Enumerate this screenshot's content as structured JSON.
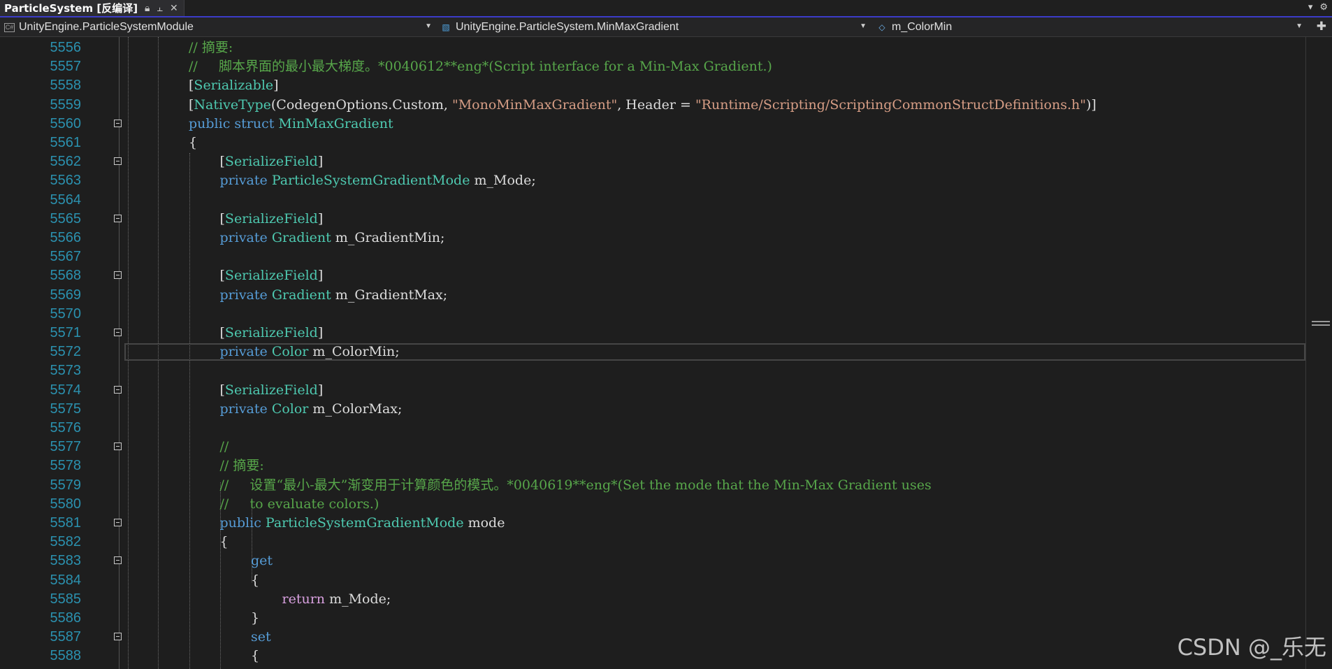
{
  "tab": {
    "title": "ParticleSystem [反编译]",
    "lock_icon": "lock-icon",
    "pin_icon": "pin-icon",
    "close_icon": "close-icon"
  },
  "navbar": {
    "project": "UnityEngine.ParticleSystemModule",
    "type": "UnityEngine.ParticleSystem.MinMaxGradient",
    "member": "m_ColorMin"
  },
  "editor": {
    "lines": [
      {
        "num": "5556",
        "indent": 2,
        "tokens": [
          [
            "c",
            "// 摘要:"
          ]
        ]
      },
      {
        "num": "5557",
        "indent": 2,
        "tokens": [
          [
            "c",
            "//     脚本界面的最小最大梯度。*0040612**eng*(Script interface for a Min-Max Gradient.)"
          ]
        ]
      },
      {
        "num": "5558",
        "indent": 2,
        "tokens": [
          [
            "p",
            "["
          ],
          [
            "t",
            "Serializable"
          ],
          [
            "p",
            "]"
          ]
        ]
      },
      {
        "num": "5559",
        "indent": 2,
        "tokens": [
          [
            "p",
            "["
          ],
          [
            "t",
            "NativeType"
          ],
          [
            "p",
            "(CodegenOptions.Custom, "
          ],
          [
            "s",
            "\"MonoMinMaxGradient\""
          ],
          [
            "p",
            ", Header = "
          ],
          [
            "s",
            "\"Runtime/Scripting/ScriptingCommonStructDefinitions.h\""
          ],
          [
            "p",
            ")]"
          ]
        ]
      },
      {
        "num": "5560",
        "indent": 2,
        "fold": true,
        "tokens": [
          [
            "k",
            "public struct "
          ],
          [
            "t",
            "MinMaxGradient"
          ]
        ]
      },
      {
        "num": "5561",
        "indent": 2,
        "tokens": [
          [
            "p",
            "{"
          ]
        ]
      },
      {
        "num": "5562",
        "indent": 3,
        "fold": true,
        "tokens": [
          [
            "p",
            "["
          ],
          [
            "t",
            "SerializeField"
          ],
          [
            "p",
            "]"
          ]
        ]
      },
      {
        "num": "5563",
        "indent": 3,
        "tokens": [
          [
            "k",
            "private "
          ],
          [
            "t",
            "ParticleSystemGradientMode"
          ],
          [
            "p",
            " m_Mode;"
          ]
        ]
      },
      {
        "num": "5564",
        "indent": 3,
        "tokens": []
      },
      {
        "num": "5565",
        "indent": 3,
        "fold": true,
        "tokens": [
          [
            "p",
            "["
          ],
          [
            "t",
            "SerializeField"
          ],
          [
            "p",
            "]"
          ]
        ]
      },
      {
        "num": "5566",
        "indent": 3,
        "tokens": [
          [
            "k",
            "private "
          ],
          [
            "t",
            "Gradient"
          ],
          [
            "p",
            " m_GradientMin;"
          ]
        ]
      },
      {
        "num": "5567",
        "indent": 3,
        "tokens": []
      },
      {
        "num": "5568",
        "indent": 3,
        "fold": true,
        "tokens": [
          [
            "p",
            "["
          ],
          [
            "t",
            "SerializeField"
          ],
          [
            "p",
            "]"
          ]
        ]
      },
      {
        "num": "5569",
        "indent": 3,
        "tokens": [
          [
            "k",
            "private "
          ],
          [
            "t",
            "Gradient"
          ],
          [
            "p",
            " m_GradientMax;"
          ]
        ]
      },
      {
        "num": "5570",
        "indent": 3,
        "tokens": []
      },
      {
        "num": "5571",
        "indent": 3,
        "fold": true,
        "tokens": [
          [
            "p",
            "["
          ],
          [
            "t",
            "SerializeField"
          ],
          [
            "p",
            "]"
          ]
        ]
      },
      {
        "num": "5572",
        "indent": 3,
        "current": true,
        "tokens": [
          [
            "k",
            "private "
          ],
          [
            "t",
            "Color"
          ],
          [
            "p",
            " m_ColorMin;"
          ]
        ]
      },
      {
        "num": "5573",
        "indent": 3,
        "tokens": []
      },
      {
        "num": "5574",
        "indent": 3,
        "fold": true,
        "tokens": [
          [
            "p",
            "["
          ],
          [
            "t",
            "SerializeField"
          ],
          [
            "p",
            "]"
          ]
        ]
      },
      {
        "num": "5575",
        "indent": 3,
        "tokens": [
          [
            "k",
            "private "
          ],
          [
            "t",
            "Color"
          ],
          [
            "p",
            " m_ColorMax;"
          ]
        ]
      },
      {
        "num": "5576",
        "indent": 3,
        "tokens": []
      },
      {
        "num": "5577",
        "indent": 3,
        "fold": true,
        "tokens": [
          [
            "c",
            "//"
          ]
        ]
      },
      {
        "num": "5578",
        "indent": 3,
        "tokens": [
          [
            "c",
            "// 摘要:"
          ]
        ]
      },
      {
        "num": "5579",
        "indent": 3,
        "tokens": [
          [
            "c",
            "//     设置“最小-最大”渐变用于计算颜色的模式。*0040619**eng*(Set the mode that the Min-Max Gradient uses"
          ]
        ]
      },
      {
        "num": "5580",
        "indent": 3,
        "tokens": [
          [
            "c",
            "//     to evaluate colors.)"
          ]
        ]
      },
      {
        "num": "5581",
        "indent": 3,
        "fold": true,
        "tokens": [
          [
            "k",
            "public "
          ],
          [
            "t",
            "ParticleSystemGradientMode"
          ],
          [
            "p",
            " mode"
          ]
        ]
      },
      {
        "num": "5582",
        "indent": 3,
        "tokens": [
          [
            "p",
            "{"
          ]
        ]
      },
      {
        "num": "5583",
        "indent": 4,
        "fold": true,
        "tokens": [
          [
            "k",
            "get"
          ]
        ]
      },
      {
        "num": "5584",
        "indent": 4,
        "tokens": [
          [
            "p",
            "{"
          ]
        ]
      },
      {
        "num": "5585",
        "indent": 5,
        "tokens": [
          [
            "cf",
            "return"
          ],
          [
            "p",
            " m_Mode;"
          ]
        ]
      },
      {
        "num": "5586",
        "indent": 4,
        "tokens": [
          [
            "p",
            "}"
          ]
        ]
      },
      {
        "num": "5587",
        "indent": 4,
        "fold": true,
        "tokens": [
          [
            "k",
            "set"
          ]
        ]
      },
      {
        "num": "5588",
        "indent": 4,
        "tokens": [
          [
            "p",
            "{"
          ]
        ]
      }
    ]
  },
  "watermark": "CSDN @_乐无",
  "colors": {
    "keyword": "#569cd6",
    "type": "#4ec9b0",
    "comment": "#57a64a",
    "string": "#d69d85",
    "control": "#d8a0df",
    "line_number": "#2b91af"
  }
}
